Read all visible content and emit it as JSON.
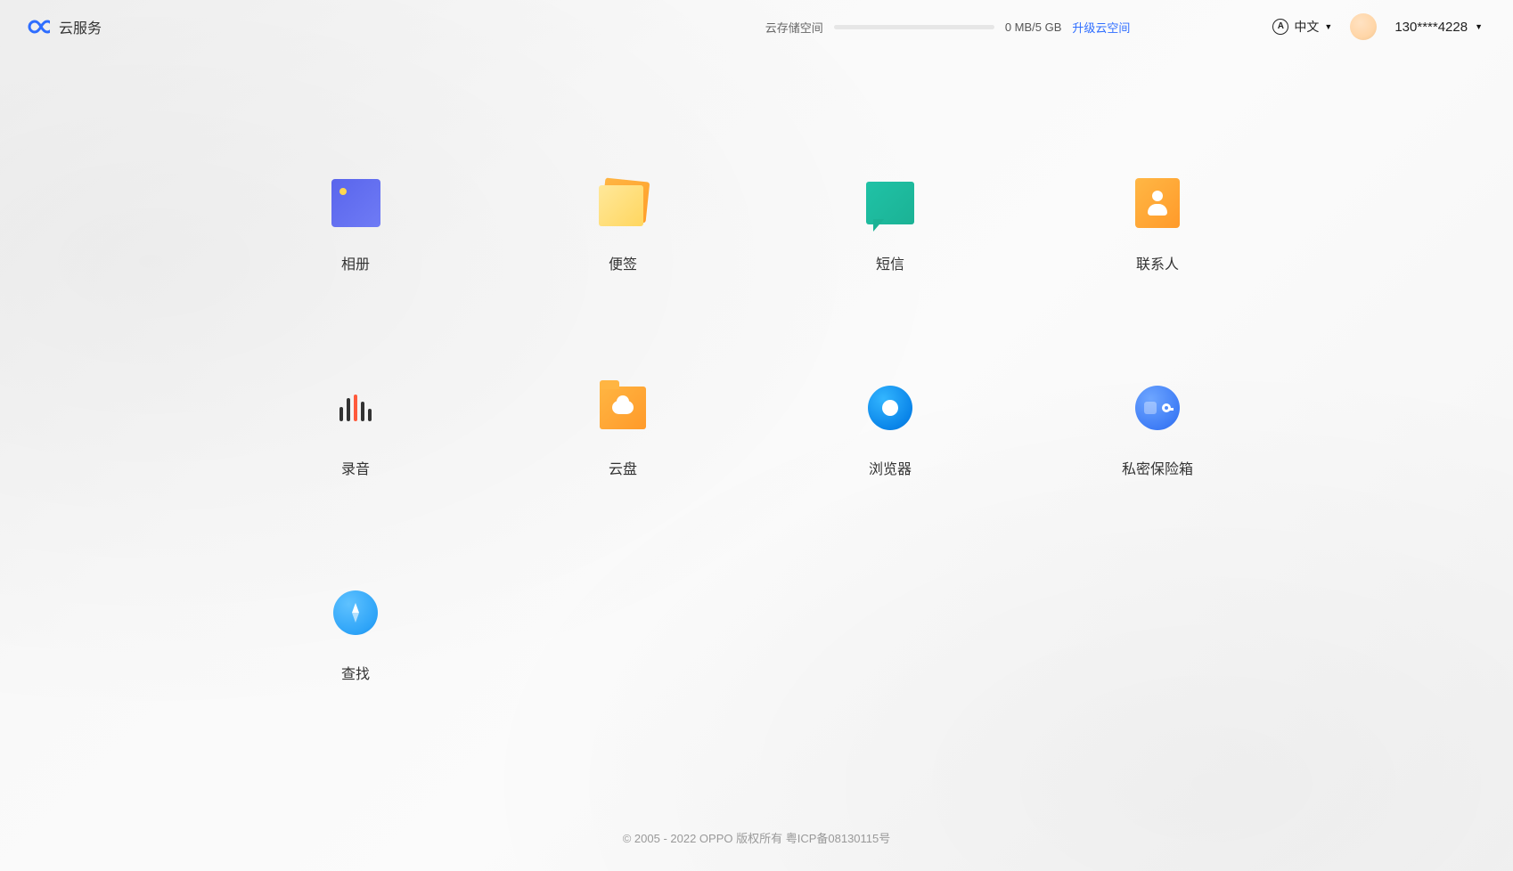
{
  "brand": "云服务",
  "storage": {
    "label": "云存储空间",
    "value": "0 MB/5 GB",
    "upgrade": "升级云空间"
  },
  "lang": {
    "label": "中文"
  },
  "user": {
    "display": "130****4228"
  },
  "tiles": {
    "photos": "相册",
    "notes": "便签",
    "sms": "短信",
    "contacts": "联系人",
    "record": "录音",
    "cloud": "云盘",
    "browser": "浏览器",
    "vault": "私密保险箱",
    "find": "查找"
  },
  "footer": "© 2005 - 2022 OPPO 版权所有  粤ICP备08130115号"
}
